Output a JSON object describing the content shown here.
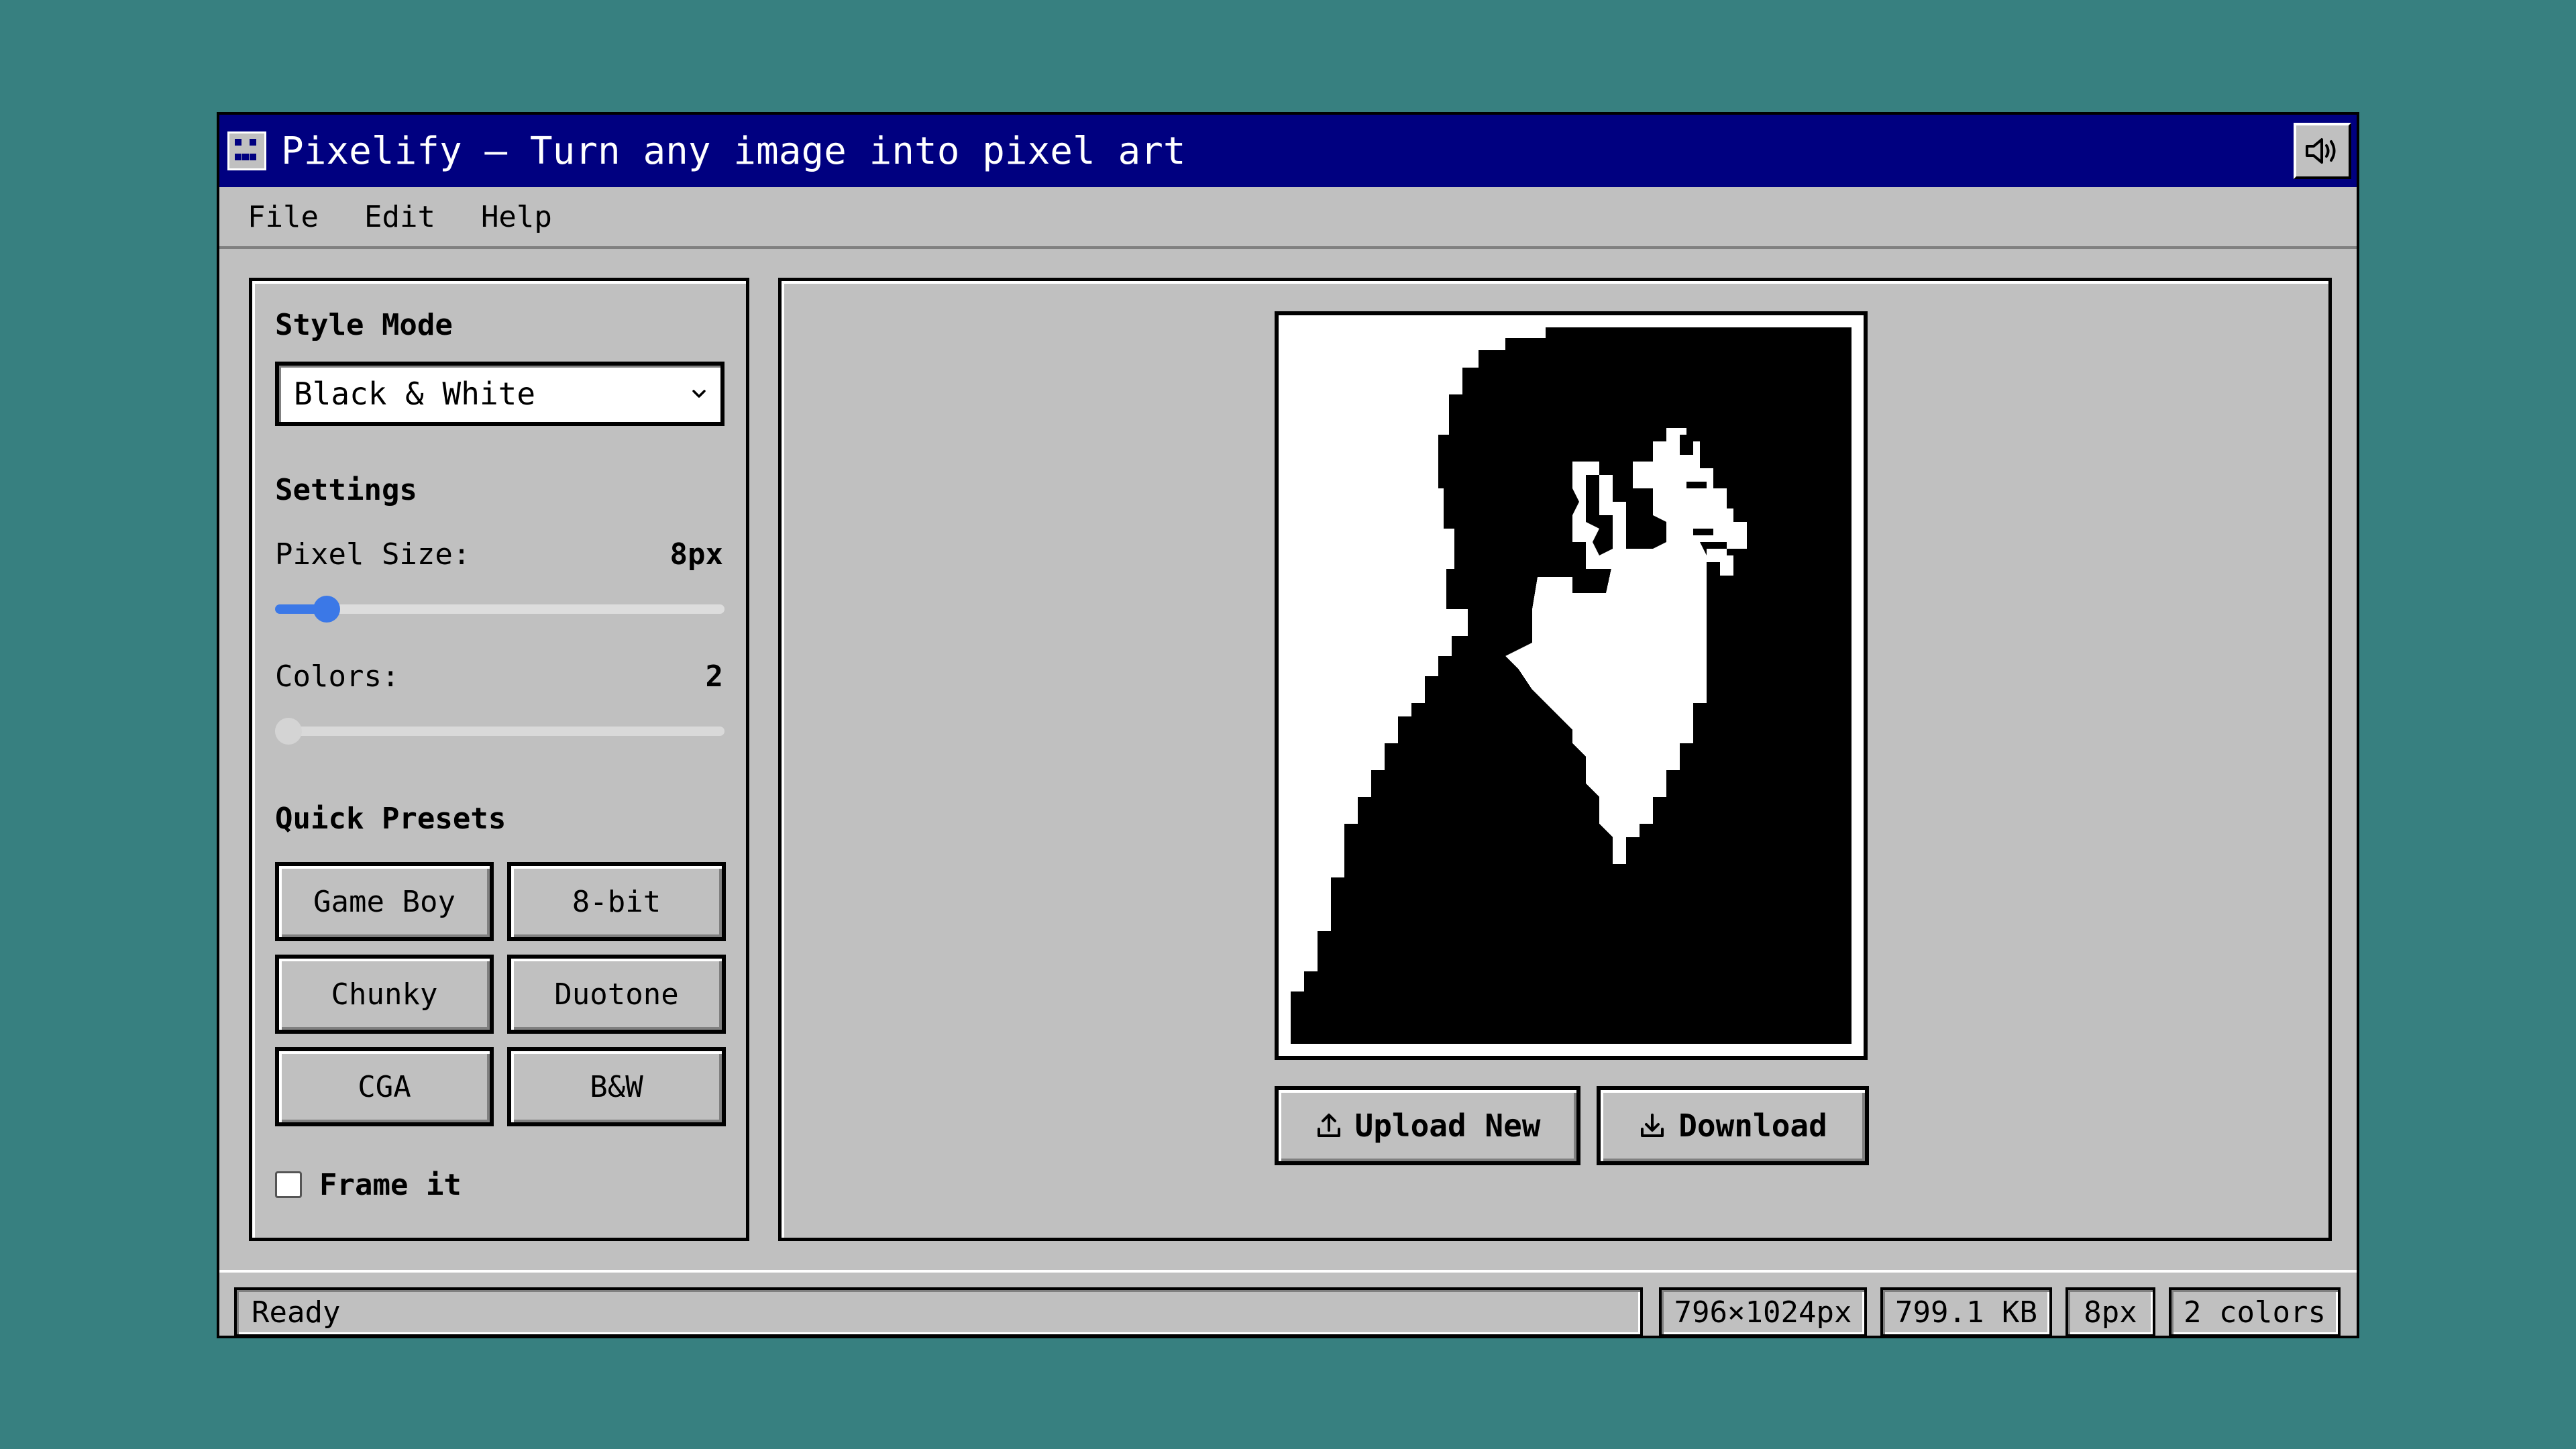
{
  "window": {
    "title": "Pixelify — Turn any image into pixel art",
    "sound_icon": "speaker-icon"
  },
  "menu": [
    "File",
    "Edit",
    "Help"
  ],
  "sidebar": {
    "style_mode_label": "Style Mode",
    "style_mode_value": "Black & White",
    "settings_label": "Settings",
    "pixel_size_label": "Pixel Size:",
    "pixel_size_value": "8px",
    "pixel_size_level": 0.09,
    "colors_label": "Colors:",
    "colors_value": "2",
    "colors_level": 0.0,
    "colors_disabled": true,
    "presets_label": "Quick Presets",
    "presets": [
      "Game Boy",
      "8-bit",
      "Chunky",
      "Duotone",
      "CGA",
      "B&W"
    ],
    "frame_label": "Frame it",
    "frame_checked": false
  },
  "canvas": {
    "upload_label": "Upload New",
    "download_label": "Download"
  },
  "status": {
    "text": "Ready",
    "dimensions": "796×1024px",
    "file_size": "799.1 KB",
    "pixel_size": "8px",
    "colors": "2 colors"
  },
  "colors": {
    "desktop": "#378080",
    "titlebar": "#000080",
    "window": "#c0c0c0",
    "accent": "#3b78e7"
  }
}
